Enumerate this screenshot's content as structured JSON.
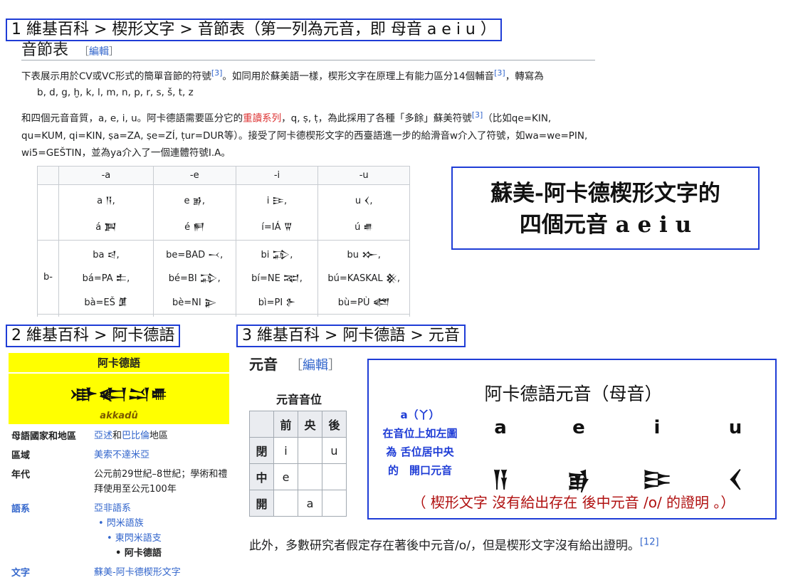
{
  "breadcrumb1": "1 維基百科 > 楔形文字 > 音節表（第一列為元音，即 母音 a e i u ）",
  "breadcrumb2": "2 維基百科 > 阿卡德語",
  "breadcrumb3": "3 維基百科 > 阿卡德語 > 元音",
  "section1": {
    "heading": "音節表",
    "edit_open": "［",
    "edit_label": "編輯",
    "edit_close": "］",
    "p1_text": "下表展示用於CV或VC形式的簡單音節的符號",
    "p1_ref1": "[3]",
    "p1_text2": "。如同用於蘇美語一樣，楔形文字在原理上有能力區分14個輔音",
    "p1_ref2": "[3]",
    "p1_text3": "，轉寫為",
    "consonants": "b, d, g, ḫ, k, l, m, n, p, r, s, š, t, z",
    "p2_text": "和四個元音音質，a, e, i, u。阿卡德語需要區分它的",
    "p2_link": "重讀系列",
    "p2_text2": "，q, ṣ, ṭ，為此採用了各種「多餘」蘇美符號",
    "p2_ref": "[3]",
    "p2_text3": "（比如qe=KIN, qu=KUM, qi=KIN, ṣa=ZA, ṣe=ZÍ, ṭur=DUR等）。接受了阿卡德楔形文字的西臺語進一步的給滑音w介入了符號，如wa=we=PIN, wi5=GEŠTIN，並為ya介入了一個連體符號I.A。",
    "table": {
      "headers": [
        "-a",
        "-e",
        "-i",
        "-u"
      ],
      "row_b_label": "b-",
      "vowel_row": [
        [
          "a 𒀀,",
          "á 𒀉"
        ],
        [
          "e 𒂊,",
          "é 𒂍"
        ],
        [
          "i 𒄿,",
          "í=IÁ 𒐊"
        ],
        [
          "u 𒌋,",
          "ú 𒌑"
        ]
      ],
      "b_row": [
        [
          "ba 𒁀,",
          "bá=PA 𒉺,",
          "bà=EŠ 𒂠"
        ],
        [
          "be=BAD 𒁁,",
          "bé=BI 𒁉,",
          "bè=NI 𒉌"
        ],
        [
          "bi 𒁉,",
          "bí=NE 𒉈,",
          "bì=PI 𒉿"
        ],
        [
          "bu 𒁍,",
          "bú=KASKAL 𒆜,",
          "bù=PÙ 𒅤"
        ]
      ]
    }
  },
  "callout": {
    "line1": "蘇美-阿卡德楔形文字的",
    "line2": "四個元音 a e i u"
  },
  "infobox": {
    "title": "阿卡德語",
    "native_cuneiform": "𒀝𒅗𒁺𒌑",
    "native_latin": "akkadû",
    "rows": [
      {
        "label": "母語國家和地區",
        "value_link1": "亞述",
        "value_mid": "和",
        "value_link2": "巴比倫",
        "value_tail": "地區"
      },
      {
        "label": "區域",
        "value_link1": "美索不達米亞"
      },
      {
        "label": "年代",
        "value_text": "公元前29世紀–8世紀；學術和禮拜使用至公元100年"
      },
      {
        "label": "語系",
        "family": [
          "亞非語系",
          "• 閃米語族",
          "• 東閃米語支",
          "• 阿卡德語"
        ]
      },
      {
        "label": "文字",
        "value_link1": "蘇美-阿卡德楔形文字"
      }
    ]
  },
  "section3": {
    "heading": "元音",
    "edit_open": "［",
    "edit_label": "編輯",
    "edit_close": "］",
    "vowel_table_title": "元音音位",
    "col_headers": [
      "前",
      "央",
      "後"
    ],
    "rows": [
      {
        "label": "閉",
        "cells": [
          "i",
          "",
          "u"
        ]
      },
      {
        "label": "中",
        "cells": [
          "e",
          "",
          ""
        ]
      },
      {
        "label": "開",
        "cells": [
          "",
          "a",
          ""
        ]
      }
    ],
    "paragraph": "此外，多數研究者假定存在著後中元音/o/，但是楔形文字沒有給出證明。",
    "paragraph_ref": "[12]"
  },
  "vowel_box": {
    "title": "阿卡德語元音（母音）",
    "note_line1": "a（丫）",
    "note_line2": "在音位上如左圖",
    "note_line3": "為 舌位居中央",
    "note_line4": "的　開口元音",
    "letters": [
      "a",
      "e",
      "i",
      "u"
    ],
    "cuneiform": [
      "𒀀",
      "𒂊",
      "𒄿",
      "𒌋"
    ],
    "bottom_note": "（ 楔形文字 沒有給出存在 後中元音 /o/ 的證明 。）"
  },
  "colors": {
    "box_border": "#1f3dd6",
    "highlight": "#ffff00",
    "link": "#3366cc",
    "red_note": "#b01010"
  }
}
